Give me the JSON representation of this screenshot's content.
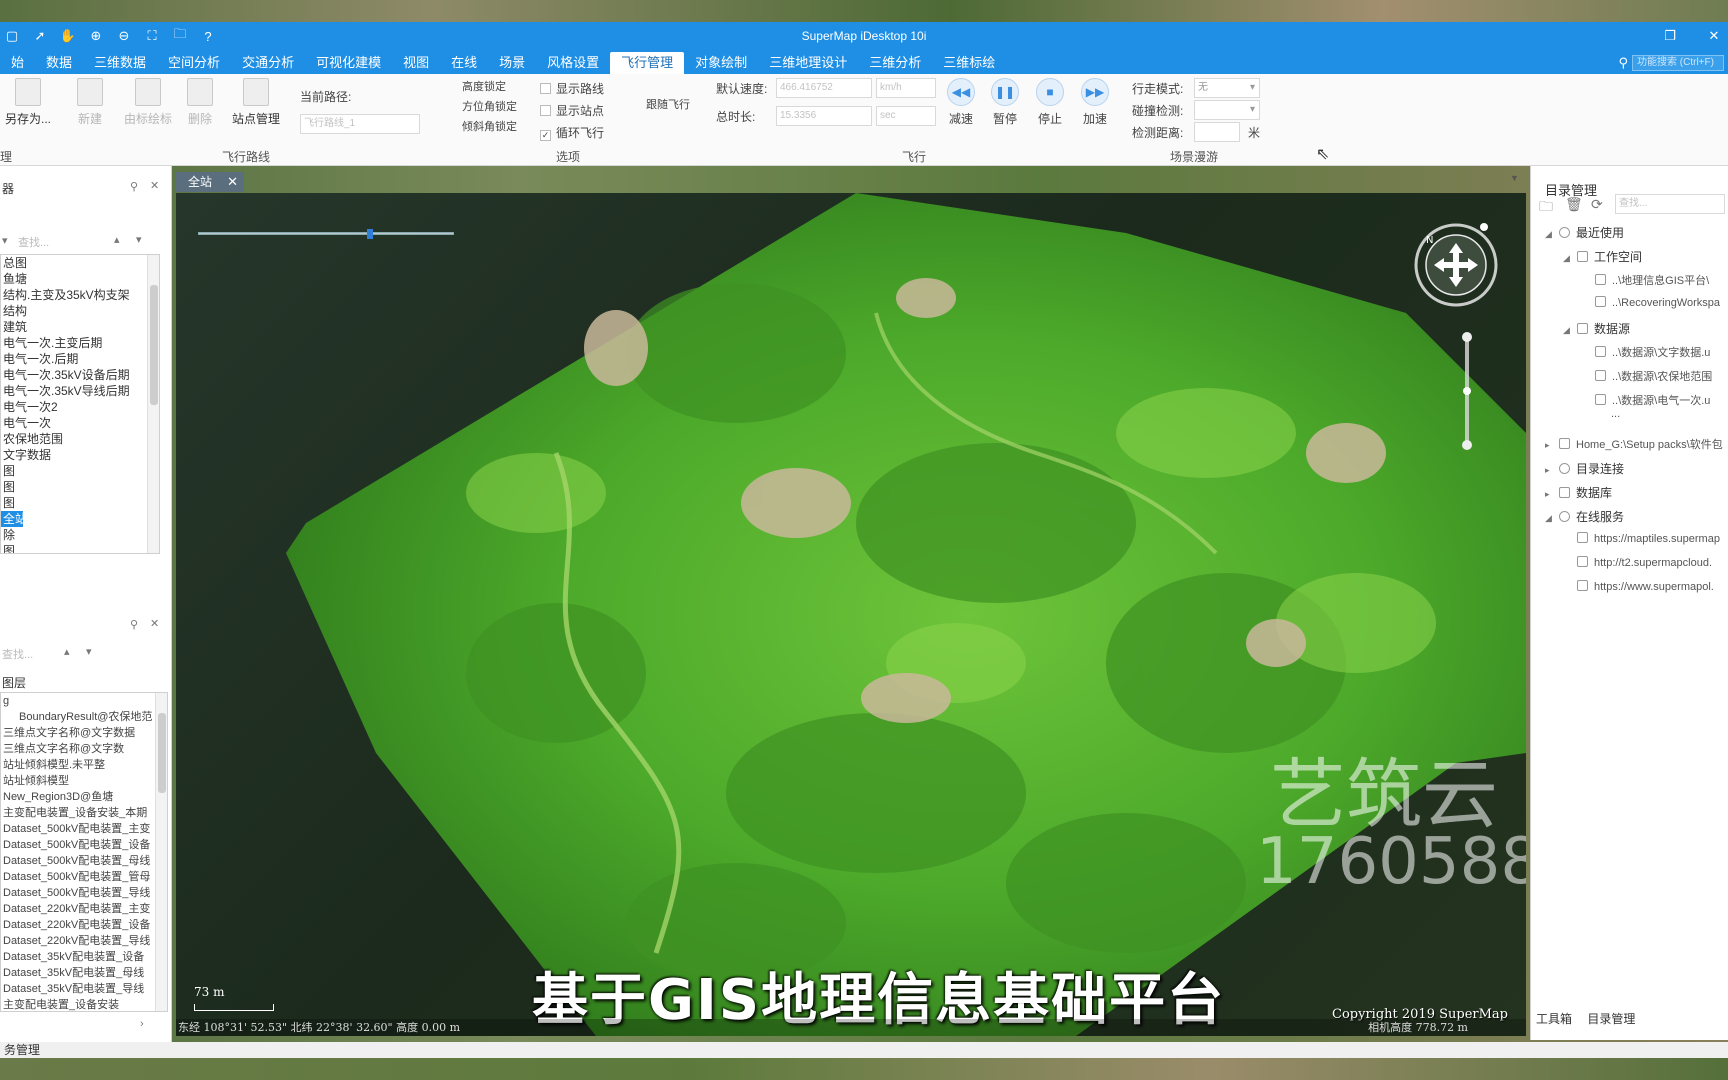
{
  "app": {
    "title": "SuperMap iDesktop 10i"
  },
  "menu": {
    "tabs": [
      {
        "label": "始"
      },
      {
        "label": "数据"
      },
      {
        "label": "三维数据"
      },
      {
        "label": "空间分析"
      },
      {
        "label": "交通分析"
      },
      {
        "label": "可视化建模"
      },
      {
        "label": "视图"
      },
      {
        "label": "在线"
      },
      {
        "label": "场景"
      },
      {
        "label": "风格设置"
      },
      {
        "label": "飞行管理"
      },
      {
        "label": "对象绘制"
      },
      {
        "label": "三维地理设计"
      },
      {
        "label": "三维分析"
      },
      {
        "label": "三维标绘"
      }
    ],
    "active_index": 10,
    "search_placeholder": "功能搜索 (Ctrl+F)"
  },
  "ribbon": {
    "route_group": {
      "save_as": "另存为...",
      "new": "新建",
      "by_tags": "由标绘标",
      "delete": "删除",
      "station_mgmt": "站点管理",
      "current_route_label": "当前路径:",
      "current_route_value": "飞行路线_1",
      "group_label": "飞行路线"
    },
    "options_group": {
      "lock_altitude": "高度锁定",
      "lock_azimuth": "方位角锁定",
      "lock_tilt": "倾斜角锁定",
      "show_route": "显示路线",
      "show_stations": "显示站点",
      "loop_flight": "循环飞行",
      "follow_flight": "跟随飞行",
      "group_label": "选项"
    },
    "fly_group": {
      "default_speed_label": "默认速度:",
      "default_speed_value": "466.416752",
      "speed_unit": "km/h",
      "total_time_label": "总时长:",
      "total_time_value": "15.3356",
      "time_unit": "sec",
      "decelerate": "减速",
      "pause": "暂停",
      "stop": "停止",
      "accelerate": "加速",
      "group_label": "飞行"
    },
    "scene_tour_group": {
      "walk_mode_label": "行走模式:",
      "walk_mode_value": "无",
      "collision_label": "碰撞检测:",
      "collision_value": "",
      "detect_dist_label": "检测距离:",
      "detect_dist_unit": "米",
      "group_label": "场景漫游"
    },
    "left_group_label": "理"
  },
  "left_panel": {
    "top_title": "器",
    "find_placeholder": "查找...",
    "tree_items": [
      "总图",
      "鱼塘",
      "结构.主变及35kV构支架",
      "结构",
      "建筑",
      "电气一次.主变后期",
      "电气一次.后期",
      "电气一次.35kV设备后期",
      "电气一次.35kV导线后期",
      "电气一次2",
      "电气一次",
      "农保地范围",
      "文字数据",
      "图",
      "图",
      "图",
      "全站",
      "除",
      "图",
      "图"
    ],
    "selected_index": 16,
    "layer_title": "图层",
    "layer_find_placeholder": "查找...",
    "layers": [
      "g",
      "BoundaryResult@农保地范",
      "三维点文字名称@文字数据",
      "三维点文字名称@文字数",
      "站址倾斜模型.未平整",
      "站址倾斜模型",
      "New_Region3D@鱼塘",
      "主变配电装置_设备安装_本期",
      "Dataset_500kV配电装置_主变",
      "Dataset_500kV配电装置_设备",
      "Dataset_500kV配电装置_母线",
      "Dataset_500kV配电装置_管母",
      "Dataset_500kV配电装置_导线",
      "Dataset_220kV配电装置_主变",
      "Dataset_220kV配电装置_设备",
      "Dataset_220kV配电装置_导线",
      "Dataset_35kV配电装置_设备",
      "Dataset_35kV配电装置_母线",
      "Dataset_35kV配电装置_导线",
      "主变配电装置_设备安装"
    ]
  },
  "document": {
    "tab_label": "全站"
  },
  "viewport": {
    "watermark_line1": "艺筑云",
    "watermark_line2": "1760588",
    "subtitle": "基于GIS地理信息基础平台",
    "copyright": "Copyright 2019 SuperMap",
    "scale_label": "73 m",
    "status_left": "东经 108°31' 52.53\"  北纬 22°38' 32.60\"  高度 0.00 m",
    "status_right": "相机高度 778.72 m",
    "compass_n": "N"
  },
  "right_panel": {
    "title": "目录管理",
    "search_placeholder": "查找...",
    "recent": "最近使用",
    "workspace": "工作空间",
    "ws_item1": "..\\地理信息GIS平台\\",
    "ws_item2": "..\\RecoveringWorkspa",
    "datasource": "数据源",
    "ds_item1": "..\\数据源\\文字数据.u",
    "ds_item2": "..\\数据源\\农保地范围",
    "ds_item3": "..\\数据源\\电气一次.u",
    "ds_more": "...",
    "home": "Home_G:\\Setup packs\\软件包",
    "dir_conn": "目录连接",
    "database": "数据库",
    "online": "在线服务",
    "online1": "https://maptiles.supermap",
    "online2": "http://t2.supermapcloud.",
    "online3": "https://www.supermapol.",
    "bottom_tab1": "工具箱",
    "bottom_tab2": "目录管理"
  },
  "bottom_status": "务管理",
  "colors": {
    "accent": "#1f8fe6",
    "active_tab_text": "#1f6fb6",
    "terrain_green": "#4caf2a"
  }
}
